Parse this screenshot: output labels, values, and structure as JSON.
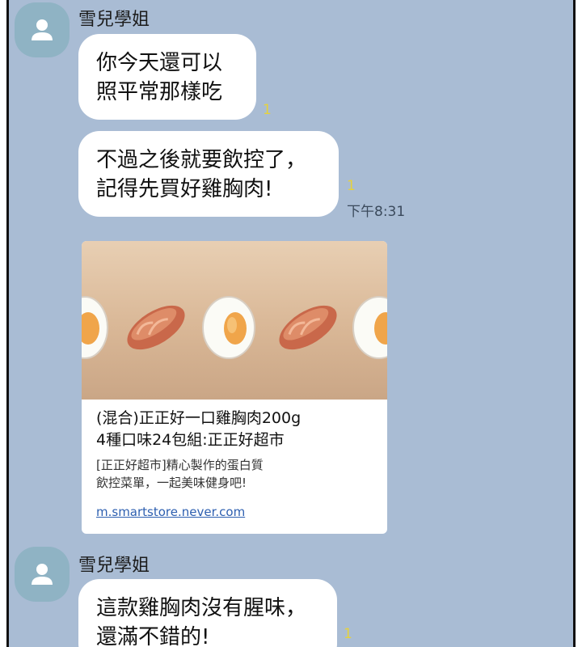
{
  "chat": {
    "messages": [
      {
        "sender": "雪兒學姐",
        "text": "你今天還可以\n照平常那樣吃",
        "read": "1"
      },
      {
        "text": "不過之後就要飲控了，\n記得先買好雞胸肉!",
        "read": "1",
        "time": "下午8:31"
      },
      {
        "sender": "雪兒學姐",
        "text": "這款雞胸肉沒有腥味，\n還滿不錯的!",
        "read": "1"
      }
    ],
    "link_card": {
      "title": "(混合)正正好一口雞胸肉200g\n4種口味24包組:正正好超市",
      "description": "[正正好超市]精心製作的蛋白質\n飲控菜單，一起美味健身吧!",
      "url": "m.smartstore.never.com"
    }
  },
  "colors": {
    "chat_background": "#a9bcd4",
    "bubble": "#ffffff",
    "read_count": "#e6d23c",
    "avatar": "#8fb3c4",
    "link": "#2d5fb0"
  },
  "icons": {
    "avatar": "person-silhouette-icon"
  }
}
